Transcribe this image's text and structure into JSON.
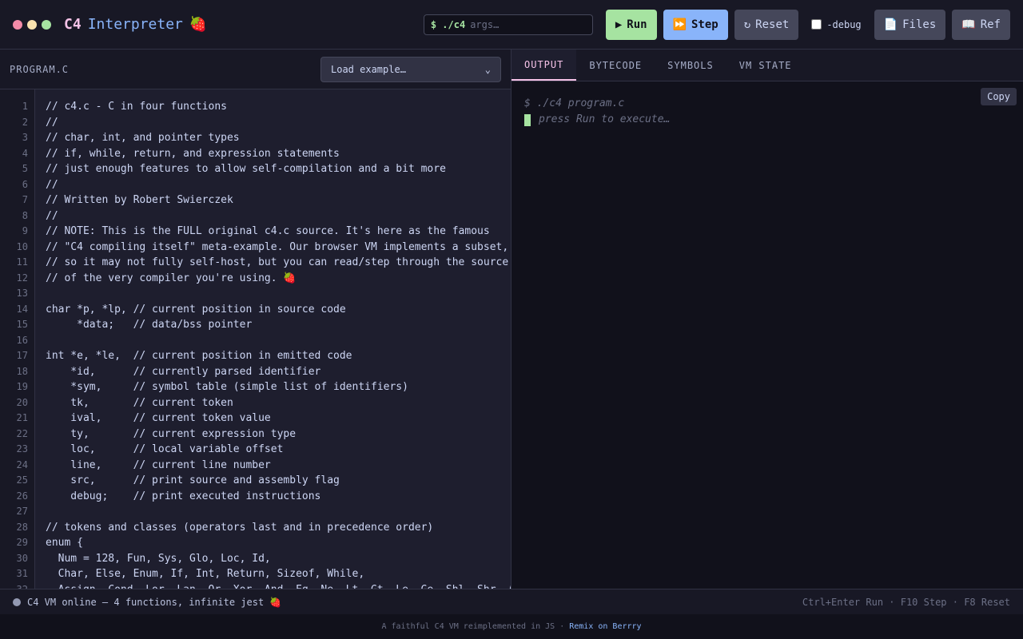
{
  "header": {
    "dots": [
      "#f38ba8",
      "#f9e2af",
      "#a6e3a1"
    ],
    "title_c4": "C4",
    "title_rest": "Interpreter",
    "title_emoji": "🍓",
    "args_prompt": "$ ./c4",
    "args_placeholder": "args…",
    "run_label": "Run",
    "run_icon": "▶",
    "step_label": "Step",
    "step_icon": "⏩",
    "reset_label": "Reset",
    "reset_icon": "↻",
    "debug_label": "-debug",
    "files_label": "Files",
    "files_icon": "📄",
    "ref_label": "Ref",
    "ref_icon": "📖"
  },
  "editor": {
    "label": "PROGRAM.C",
    "select_value": "Load example…",
    "lines": [
      "// c4.c - C in four functions",
      "//",
      "// char, int, and pointer types",
      "// if, while, return, and expression statements",
      "// just enough features to allow self-compilation and a bit more",
      "//",
      "// Written by Robert Swierczek",
      "//",
      "// NOTE: This is the FULL original c4.c source. It's here as the famous",
      "// \"C4 compiling itself\" meta-example. Our browser VM implements a subset,",
      "// so it may not fully self-host, but you can read/step through the source",
      "// of the very compiler you're using. 🍓",
      "",
      "char *p, *lp, // current position in source code",
      "     *data;   // data/bss pointer",
      "",
      "int *e, *le,  // current position in emitted code",
      "    *id,      // currently parsed identifier",
      "    *sym,     // symbol table (simple list of identifiers)",
      "    tk,       // current token",
      "    ival,     // current token value",
      "    ty,       // current expression type",
      "    loc,      // local variable offset",
      "    line,     // current line number",
      "    src,      // print source and assembly flag",
      "    debug;    // print executed instructions",
      "",
      "// tokens and classes (operators last and in precedence order)",
      "enum {",
      "  Num = 128, Fun, Sys, Glo, Loc, Id,",
      "  Char, Else, Enum, If, Int, Return, Sizeof, While,",
      "  Assign, Cond, Lor, Lan, Or, Xor, And, Eq, Ne, Lt, Gt, Le, Ge, Shl, Shr, Add"
    ]
  },
  "tabs": [
    {
      "label": "OUTPUT",
      "active": true
    },
    {
      "label": "BYTECODE",
      "active": false
    },
    {
      "label": "SYMBOLS",
      "active": false
    },
    {
      "label": "VM STATE",
      "active": false
    }
  ],
  "output": {
    "command": "$ ./c4 program.c",
    "hint": "press Run to execute…",
    "copy_label": "Copy"
  },
  "status": {
    "message": "C4 VM online — 4 functions, infinite jest 🍓",
    "shortcuts": "Ctrl+Enter Run · F10 Step · F8 Reset"
  },
  "footer": {
    "text": "A faithful C4 VM reimplemented in JS ·",
    "link": "Remix on Berrry"
  }
}
